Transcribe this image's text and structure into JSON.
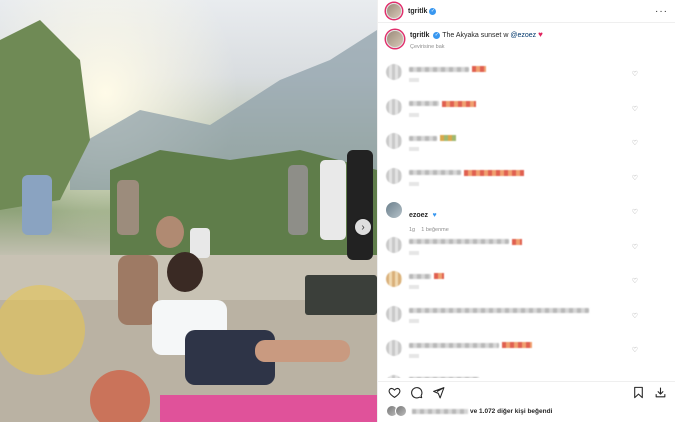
{
  "post": {
    "author": "tgritlk",
    "caption_text": "The Akyaka sunset w",
    "caption_mention": "@ezoez",
    "translate_label": "Çevirisine bak"
  },
  "comments": [
    {
      "blurred": true
    },
    {
      "blurred": true
    },
    {
      "blurred": true
    },
    {
      "blurred": true
    },
    {
      "username": "ezoez",
      "time": "1g",
      "likes": "1 beğenme"
    },
    {
      "blurred": true
    },
    {
      "blurred": true
    },
    {
      "blurred": true
    },
    {
      "blurred": true
    },
    {
      "blurred": true
    }
  ],
  "likes": {
    "others_text": "ve 1.072 diğer kişi beğendi"
  },
  "icons": [
    "verified-badge-icon",
    "more-options-icon",
    "heart-icon",
    "comment-icon",
    "share-icon",
    "bookmark-icon",
    "save-icon",
    "carousel-next-icon"
  ],
  "colors": {
    "verified": "#3897f0",
    "heart_red": "#e0245e",
    "mention": "#00376b"
  }
}
